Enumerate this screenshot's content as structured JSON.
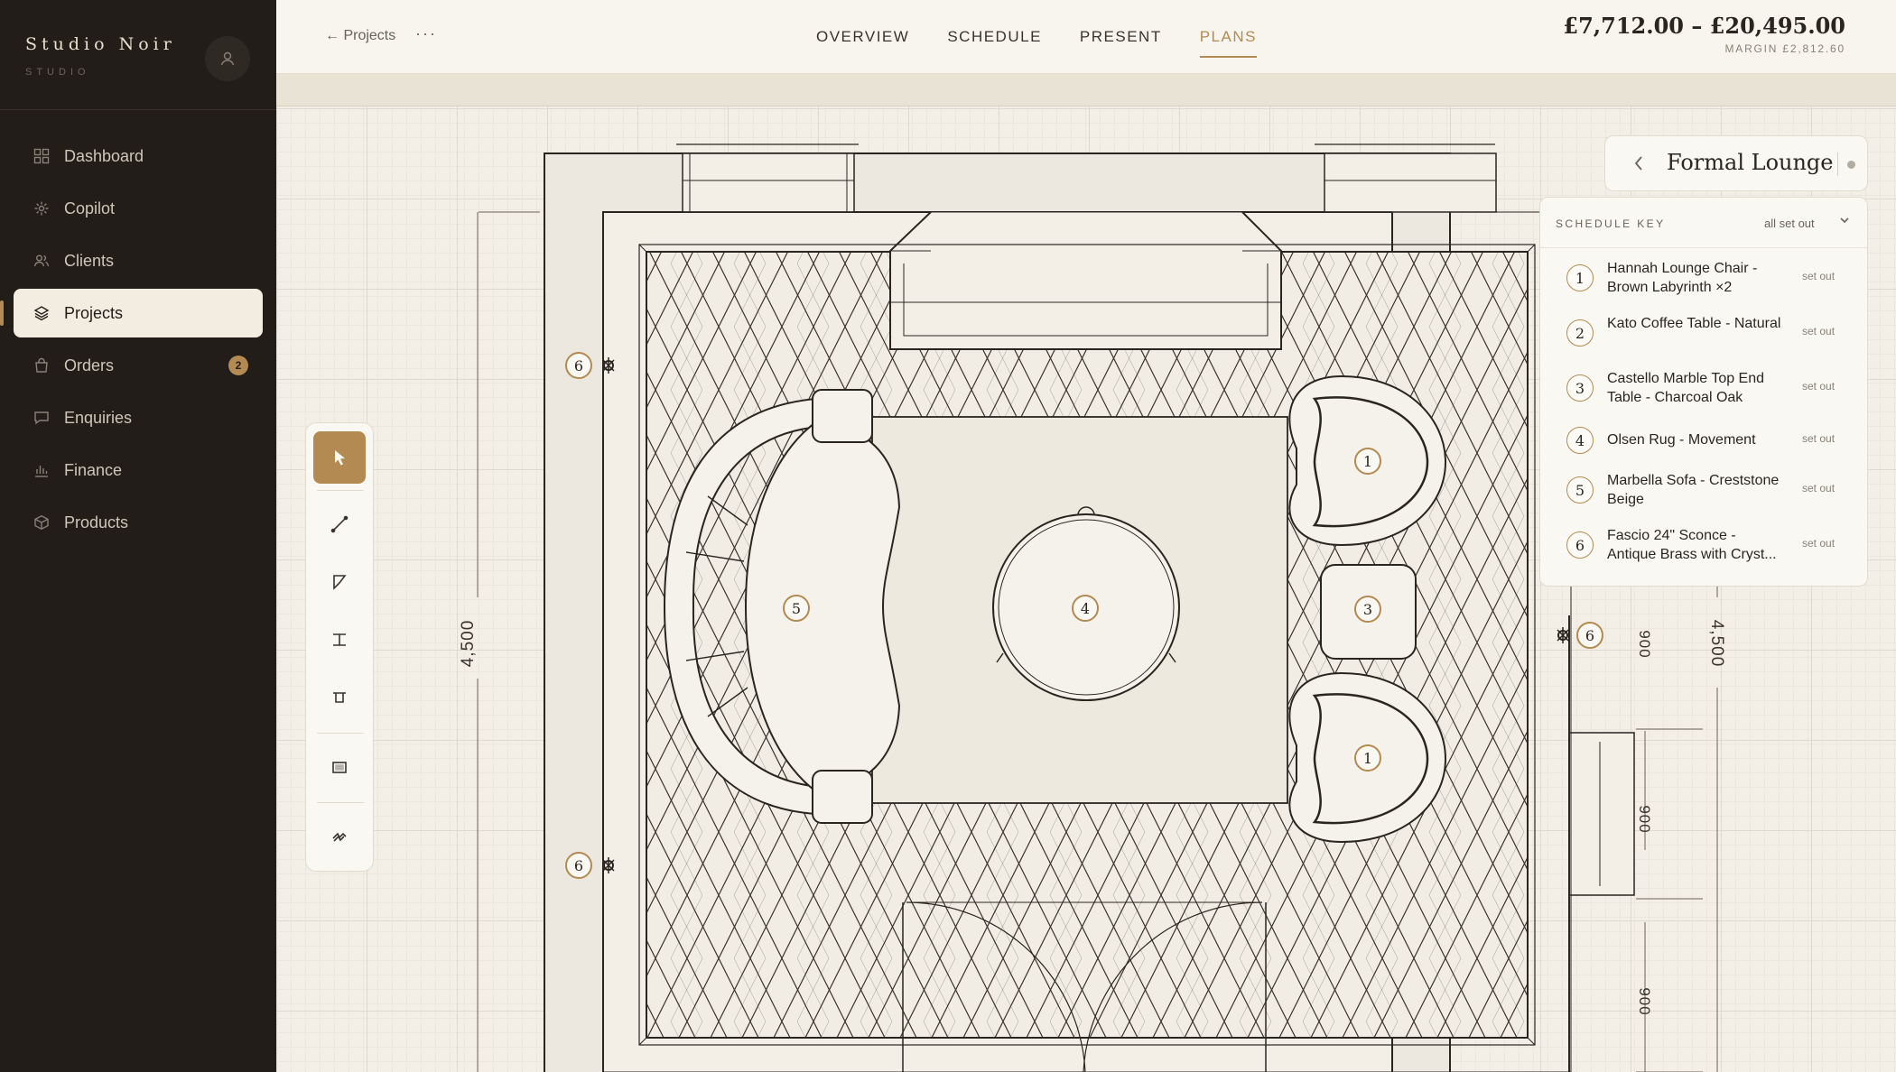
{
  "sidebar": {
    "brand_name": "Studio Noir",
    "brand_sub": "STUDIO",
    "items": [
      {
        "label": "Dashboard",
        "icon": "grid-icon"
      },
      {
        "label": "Copilot",
        "icon": "sparkle-icon"
      },
      {
        "label": "Clients",
        "icon": "users-icon"
      },
      {
        "label": "Projects",
        "icon": "layers-icon",
        "active": true
      },
      {
        "label": "Orders",
        "icon": "bag-icon",
        "badge": "2"
      },
      {
        "label": "Enquiries",
        "icon": "chat-icon"
      },
      {
        "label": "Finance",
        "icon": "bar-chart-icon"
      },
      {
        "label": "Products",
        "icon": "box-icon"
      }
    ]
  },
  "topbar": {
    "back_label": "← Projects",
    "more_label": "···",
    "tabs": [
      {
        "label": "OVERVIEW"
      },
      {
        "label": "SCHEDULE"
      },
      {
        "label": "PRESENT"
      },
      {
        "label": "PLANS",
        "active": true
      }
    ],
    "price_range": "£7,712.00 – £20,495.00",
    "margin": "MARGIN £2,812.60"
  },
  "room": {
    "title": "Formal Lounge",
    "back_icon": "chevron-left-icon"
  },
  "schedule": {
    "title": "SCHEDULE KEY",
    "filter": "all set out",
    "items": [
      {
        "num": "1",
        "name": "Hannah Lounge Chair - Brown Labyrinth ×2",
        "status": "set out"
      },
      {
        "num": "2",
        "name": "Kato Coffee Table - Natural",
        "status": "set out"
      },
      {
        "num": "3",
        "name": "Castello Marble Top End Table - Charcoal Oak",
        "status": "set out"
      },
      {
        "num": "4",
        "name": "Olsen Rug - Movement",
        "status": "set out"
      },
      {
        "num": "5",
        "name": "Marbella Sofa - Creststone Beige",
        "status": "set out"
      },
      {
        "num": "6",
        "name": "Fascio 24\" Sconce - Antique Brass with Cryst...",
        "status": "set out"
      }
    ]
  },
  "plan": {
    "markers": {
      "sofa": "5",
      "rug": "4",
      "end_table": "3",
      "chair": "1",
      "sconce": "6"
    },
    "dimensions": {
      "left": "4,500",
      "right": "4,500",
      "seg1": "900",
      "seg2": "900",
      "seg3": "900"
    }
  },
  "colors": {
    "accent": "#b38a52",
    "sidebar_bg": "#221d19",
    "canvas_bg": "#f3efe6"
  }
}
